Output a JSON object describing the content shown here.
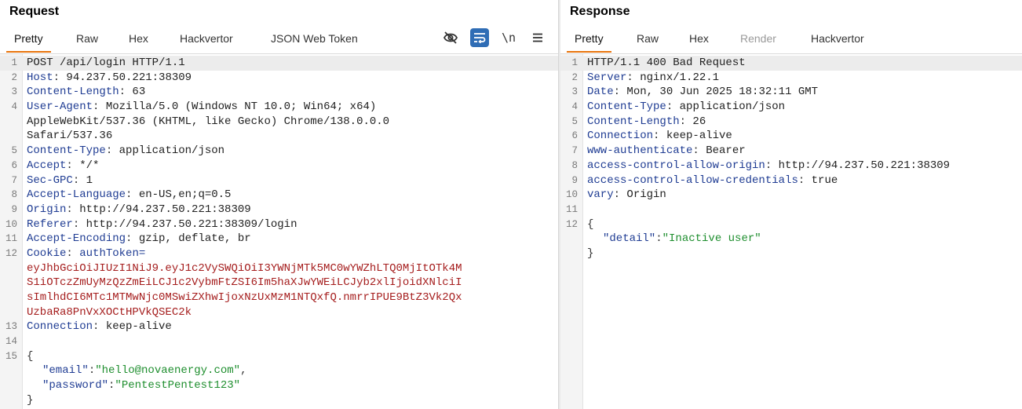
{
  "request": {
    "title": "Request",
    "tabs": [
      "Pretty",
      "Raw",
      "Hex",
      "Hackvertor",
      "JSON Web Token"
    ],
    "icons": [
      "eye-slash-icon",
      "wrap-lines-icon",
      "newline-icon",
      "menu-icon"
    ],
    "newline_label": "\\n",
    "line1": "POST /api/login HTTP/1.1",
    "headers": [
      {
        "k": "Host",
        "v": " 94.237.50.221:38309"
      },
      {
        "k": "Content-Length",
        "v": " 63"
      },
      {
        "k": "User-Agent",
        "v": " Mozilla/5.0 (Windows NT 10.0; Win64; x64)"
      },
      {
        "k": "",
        "v": "AppleWebKit/537.36 (KHTML, like Gecko) Chrome/138.0.0.0"
      },
      {
        "k": "",
        "v": "Safari/537.36"
      },
      {
        "k": "Content-Type",
        "v": " application/json"
      },
      {
        "k": "Accept",
        "v": " */*"
      },
      {
        "k": "Sec-GPC",
        "v": " 1"
      },
      {
        "k": "Accept-Language",
        "v": " en-US,en;q=0.5"
      },
      {
        "k": "Origin",
        "v": " http://94.237.50.221:38309"
      },
      {
        "k": "Referer",
        "v": " http://94.237.50.221:38309/login"
      },
      {
        "k": "Accept-Encoding",
        "v": " gzip, deflate, br"
      }
    ],
    "cookie_key": "Cookie",
    "cookie_name": "authToken=",
    "cookie_value": [
      "eyJhbGciOiJIUzI1NiJ9.eyJ1c2VySWQiOiI3YWNjMTk5MC0wYWZhLTQ0MjItOTk4M",
      "S1iOTczZmUyMzQzZmEiLCJ1c2VybmFtZSI6Im5haXJwYWEiLCJyb2xlIjoidXNlciI",
      "sImlhdCI6MTc1MTMwNjc0MSwiZXhwIjoxNzUxMzM1NTQxfQ.nmrrIPUE9BtZ3Vk2Qx",
      "UzbaRa8PnVxXOCtHPVkQSEC2k"
    ],
    "connection": {
      "k": "Connection",
      "v": " keep-alive"
    },
    "body": {
      "open": "{",
      "email_key": "\"email\"",
      "email_val": "\"hello@novaenergy.com\"",
      "password_key": "\"password\"",
      "password_val": "\"PentestPentest123\"",
      "close": "}"
    },
    "line_numbers": [
      "1",
      "2",
      "3",
      "4",
      "",
      "",
      "5",
      "6",
      "7",
      "8",
      "9",
      "10",
      "11",
      "12",
      "",
      "",
      "",
      "",
      "13",
      "14",
      "15",
      "",
      "",
      ""
    ]
  },
  "response": {
    "title": "Response",
    "tabs": [
      "Pretty",
      "Raw",
      "Hex",
      "Render",
      "Hackvertor"
    ],
    "status_line": "HTTP/1.1 400 Bad Request",
    "headers": [
      {
        "k": "Server",
        "v": " nginx/1.22.1"
      },
      {
        "k": "Date",
        "v": " Mon, 30 Jun 2025 18:32:11 GMT"
      },
      {
        "k": "Content-Type",
        "v": " application/json"
      },
      {
        "k": "Content-Length",
        "v": " 26"
      },
      {
        "k": "Connection",
        "v": " keep-alive"
      },
      {
        "k": "www-authenticate",
        "v": " Bearer"
      },
      {
        "k": "access-control-allow-origin",
        "v": " http://94.237.50.221:38309"
      },
      {
        "k": "access-control-allow-credentials",
        "v": " true"
      },
      {
        "k": "vary",
        "v": " Origin"
      }
    ],
    "body": {
      "open": "{",
      "detail_key": "\"detail\"",
      "detail_val": "\"Inactive user\"",
      "close": "}"
    },
    "line_numbers": [
      "1",
      "2",
      "3",
      "4",
      "5",
      "6",
      "7",
      "8",
      "9",
      "10",
      "11",
      "12",
      "",
      ""
    ]
  },
  "colors": {
    "header_key": "#1f3c93",
    "cookie_value": "#a51d1d",
    "string": "#1e8e2e",
    "active_tab_underline": "#e8740c",
    "active_icon_bg": "#2f6db5"
  }
}
